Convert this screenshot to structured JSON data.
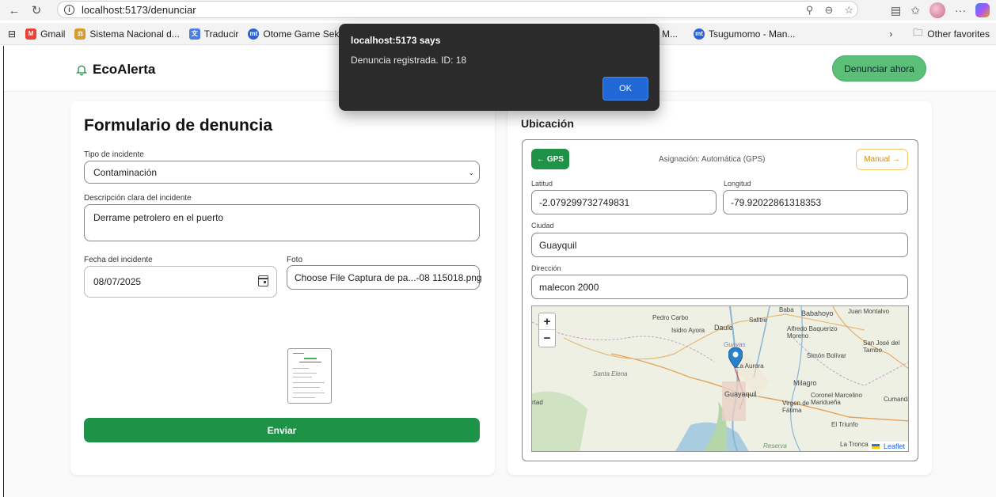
{
  "browser": {
    "url": "localhost:5173/denunciar",
    "bookmarks": [
      "Gmail",
      "Sistema Nacional d...",
      "Traducir",
      "Otome Game Seka",
      "M...",
      "Tsugumomo - Man..."
    ],
    "other_favorites": "Other favorites"
  },
  "header": {
    "brand": "EcoAlerta",
    "cta_label": "Denunciar ahora"
  },
  "form": {
    "title": "Formulario de denuncia",
    "incident_type_label": "Tipo de incidente",
    "incident_type_value": "Contaminación",
    "description_label": "Descripción clara del incidente",
    "description_value": "Derrame petrolero en el puerto",
    "date_label": "Fecha del incidente",
    "date_value": "08/07/2025",
    "photo_label": "Foto",
    "photo_value": "Choose File Captura de pa...-08 115018.png",
    "submit_label": "Enviar"
  },
  "location": {
    "title": "Ubicación",
    "gps_label": "← GPS",
    "assignment_text": "Asignación: Automática (GPS)",
    "manual_label": "Manual →",
    "latitude_label": "Latitud",
    "latitude_value": "-2.079299732749831",
    "longitude_label": "Longitud",
    "longitude_value": "-79.92022861318353",
    "city_label": "Ciudad",
    "city_value": "Guayquil",
    "address_label": "Dirección",
    "address_value": "malecon 2000",
    "map": {
      "zoom_in": "+",
      "zoom_out": "−",
      "attribution": "Leaflet",
      "labels": [
        "Pedro Carbo",
        "Isidro Ayora",
        "Daule",
        "Salitre",
        "Baba",
        "Babahoyo",
        "Juan Montalvo",
        "Alfredo Baquerizo Moreno",
        "San José del Tambo",
        "Simón Bolívar",
        "Santa Elena",
        "Guayas",
        "La Aurora",
        "Guayaquil",
        "Milagro",
        "Coronel Marcelino Maridueña",
        "Virgen de Fátima",
        "Cumandá",
        "El Triunfo",
        "La Troncal",
        "Reserva",
        "rtad"
      ]
    }
  },
  "dialog": {
    "title": "localhost:5173 says",
    "message": "Denuncia registrada. ID: 18",
    "ok_label": "OK"
  }
}
